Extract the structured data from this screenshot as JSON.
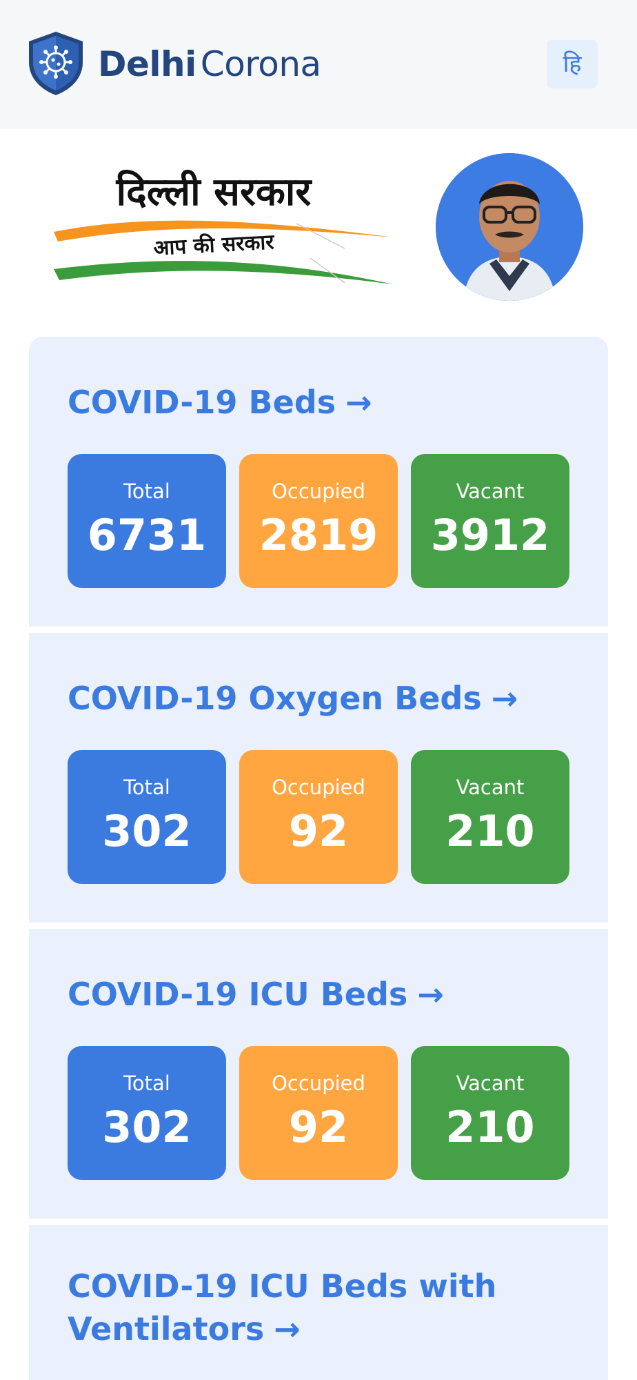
{
  "header": {
    "brand_bold": "Delhi",
    "brand_regular": "Corona",
    "language_toggle": "हि"
  },
  "govt_banner": {
    "title": "दिल्ली सरकार",
    "tagline": "आप की सरकार"
  },
  "colors": {
    "accent": "#3b7be0",
    "total": "#3b7be0",
    "occupied": "#ffa640",
    "vacant": "#45a047",
    "section_bg": "#eaf1fc",
    "brand": "#23467f"
  },
  "sections": [
    {
      "title": "COVID-19 Beds",
      "arrow": "→",
      "stats": {
        "total_label": "Total",
        "total_value": "6731",
        "occupied_label": "Occupied",
        "occupied_value": "2819",
        "vacant_label": "Vacant",
        "vacant_value": "3912"
      }
    },
    {
      "title": "COVID-19 Oxygen Beds",
      "arrow": "→",
      "stats": {
        "total_label": "Total",
        "total_value": "302",
        "occupied_label": "Occupied",
        "occupied_value": "92",
        "vacant_label": "Vacant",
        "vacant_value": "210"
      }
    },
    {
      "title": "COVID-19 ICU Beds",
      "arrow": "→",
      "stats": {
        "total_label": "Total",
        "total_value": "302",
        "occupied_label": "Occupied",
        "occupied_value": "92",
        "vacant_label": "Vacant",
        "vacant_value": "210"
      }
    },
    {
      "title": "COVID-19 ICU Beds with Ventilators",
      "arrow": "→"
    }
  ],
  "icons": [
    "shield-virus-icon",
    "arrow-right-icon",
    "cm-avatar"
  ]
}
